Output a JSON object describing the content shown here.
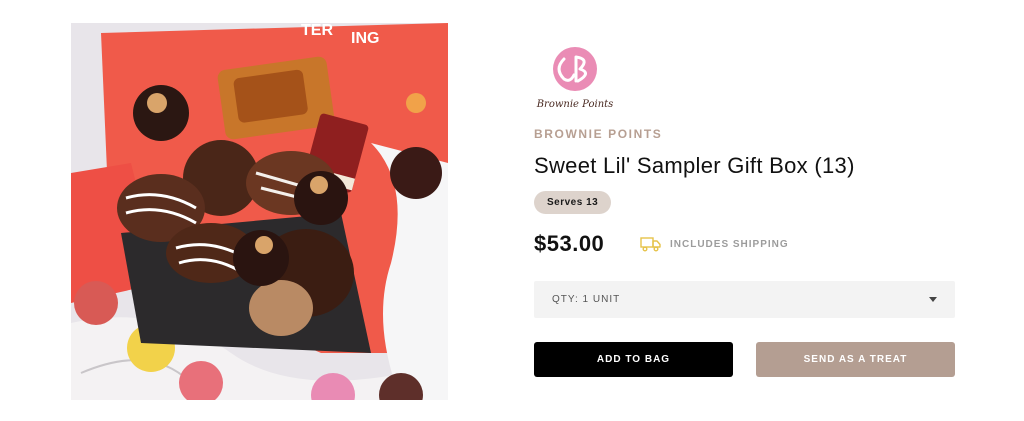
{
  "product": {
    "image_alt": "Sweet Lil' Sampler Gift Box",
    "logo_text": "Brownie Points",
    "brand": "BROWNIE POINTS",
    "title": "Sweet Lil' Sampler Gift Box (13)",
    "serves_badge": "Serves 13",
    "price": "$53.00",
    "shipping_label": "INCLUDES SHIPPING",
    "quantity_selected": "QTY: 1 UNIT",
    "add_to_bag_label": "ADD TO BAG",
    "send_treat_label": "SEND AS A TREAT"
  },
  "icons": {
    "shipping": "truck-icon",
    "dropdown": "chevron-down-icon"
  },
  "colors": {
    "brand": "#b79f92",
    "badge_bg": "#ddd3cc",
    "primary_button": "#000000",
    "secondary_button": "#b49e92",
    "logo_pink": "#ea8cb5",
    "truck_icon": "#e6c34a"
  }
}
